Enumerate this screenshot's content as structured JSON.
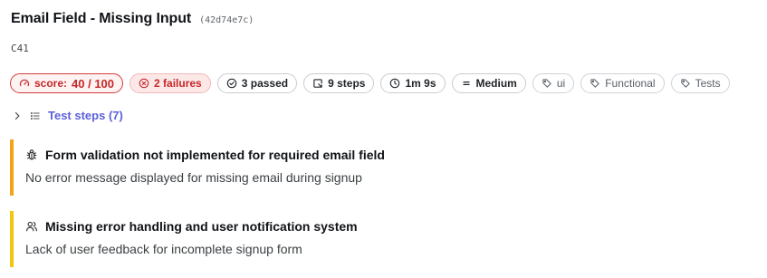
{
  "header": {
    "title": "Email Field - Missing Input",
    "hash": "(42d74e7c)",
    "code": "C41"
  },
  "badges": {
    "score_label": "score:",
    "score_value": "40 / 100",
    "failures": "2 failures",
    "passed": "3 passed",
    "steps": "9 steps",
    "duration": "1m 9s",
    "priority": "Medium",
    "tags": [
      "ui",
      "Functional",
      "Tests"
    ]
  },
  "test_steps": {
    "label": "Test steps (7)"
  },
  "issues": [
    {
      "icon": "bug-icon",
      "title": "Form validation not implemented for required email field",
      "description": "No error message displayed for missing email during signup",
      "accent": "#f5a316"
    },
    {
      "icon": "users-icon",
      "title": "Missing error handling and user notification system",
      "description": "Lack of user feedback for incomplete signup form",
      "accent": "#f3c60f"
    }
  ],
  "colors": {
    "score": "#c62828",
    "link": "#5b61d9"
  }
}
